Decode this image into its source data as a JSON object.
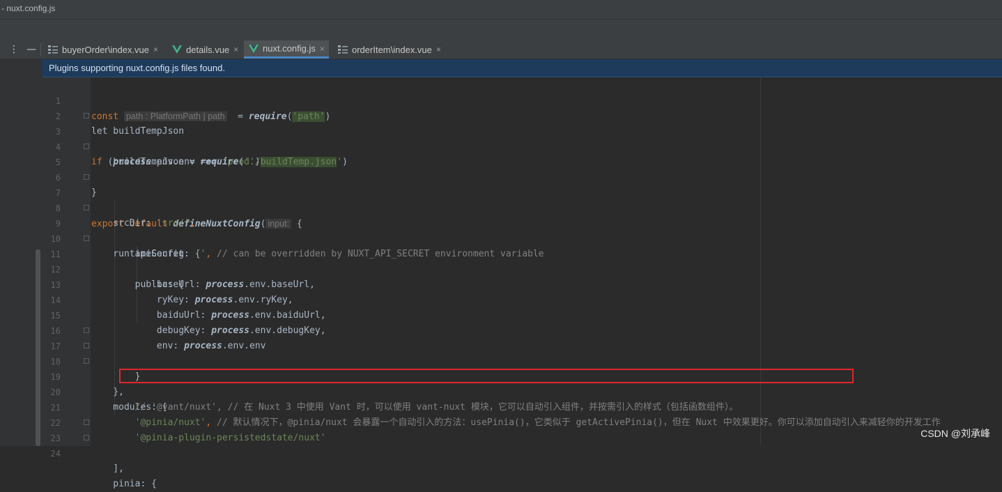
{
  "window": {
    "title": "- nuxt.config.js"
  },
  "toolbar": {
    "menu_glyph": "⋮",
    "minimize_glyph": "—"
  },
  "tabs": [
    {
      "label": "buyerOrder\\index.vue",
      "icon": "component-icon",
      "active": false
    },
    {
      "label": "details.vue",
      "icon": "vue-icon",
      "active": false
    },
    {
      "label": "nuxt.config.js",
      "icon": "vue-icon",
      "active": true
    },
    {
      "label": "orderItem\\index.vue",
      "icon": "component-icon",
      "active": false
    }
  ],
  "close_glyph": "×",
  "banner": {
    "text": "Plugins supporting nuxt.config.js files found."
  },
  "hints": {
    "path_name": "path",
    "path_type": ": PlatformPath | path",
    "input": "input:"
  },
  "code": {
    "l1_kw": "const ",
    "l1_rest": "  = ",
    "l1_fn": "require",
    "l1_open": "(",
    "l1_str": "'path'",
    "l1_close": ")",
    "l2": "let buildTempJson",
    "l3_kw": "if",
    "l3_a": " (",
    "l3_proc": "process",
    "l3_b": ".env.env === ",
    "l3_str": "'prod'",
    "l3_c": ") {",
    "l4_a": "    buildTempJson = ",
    "l4_fn": "require",
    "l4_b": "(",
    "l4_str1": "'./",
    "l4_str2": "buildTemp.json",
    "l4_str3": "'",
    "l4_c": ")",
    "l5": "}",
    "l7_kw": "export default ",
    "l7_fn": "defineNuxtConfig",
    "l7_a": "(",
    "l7_b": " {",
    "l8_a": "    srcDir: ",
    "l8_str": "'src/'",
    "l8_b": ",",
    "l9": "    runtimeConfig: {",
    "l10_a": "        apiSecret: ",
    "l10_str": "''",
    "l10_b": ", ",
    "l10_cmt": "// can be overridden by NUXT_API_SECRET environment variable",
    "l11": "        public: {",
    "l12_a": "            baseUrl: ",
    "l12_p": "process",
    "l12_b": ".env.baseUrl,",
    "l13_a": "            ryKey: ",
    "l13_p": "process",
    "l13_b": ".env.ryKey,",
    "l14_a": "            baiduUrl: ",
    "l14_p": "process",
    "l14_b": ".env.baiduUrl,",
    "l15_a": "            debugKey: ",
    "l15_p": "process",
    "l15_b": ".env.debugKey,",
    "l16_a": "            env: ",
    "l16_p": "process",
    "l16_b": ".env.env",
    "l17": "        }",
    "l18": "    },",
    "l19": "    modules: [",
    "l20_cmt": "        // '@vant/nuxt', // 在 Nuxt 3 中使用 Vant 时，可以使用 vant-nuxt 模块，它可以自动引入组件，并按需引入的样式（包括函数组件）。",
    "l21_a": "        ",
    "l21_str": "'@pinia/nuxt'",
    "l21_b": ", ",
    "l21_cmt": "// 默认情况下，@pinia/nuxt 会暴露一个自动引入的方法：usePinia()，它类似于 getActivePinia()，但在 Nuxt 中效果更好。你可以添加自动引入来减轻你的开发工作",
    "l22_a": "        ",
    "l22_str": "'@pinia-plugin-persistedstate/nuxt'",
    "l23": "    ],",
    "l24": "    pinia: {"
  },
  "line_numbers": [
    "1",
    "2",
    "3",
    "4",
    "5",
    "6",
    "7",
    "8",
    "9",
    "10",
    "11",
    "12",
    "13",
    "14",
    "15",
    "16",
    "17",
    "18",
    "19",
    "20",
    "21",
    "22",
    "23",
    "24"
  ],
  "watermark": "CSDN @刘承峰",
  "colors": {
    "keyword": "#cc7832",
    "string": "#6a8759",
    "function": "#ffc66d",
    "comment": "#808080",
    "banner_bg": "#1e3b5c",
    "highlight_box": "#e0262b"
  }
}
